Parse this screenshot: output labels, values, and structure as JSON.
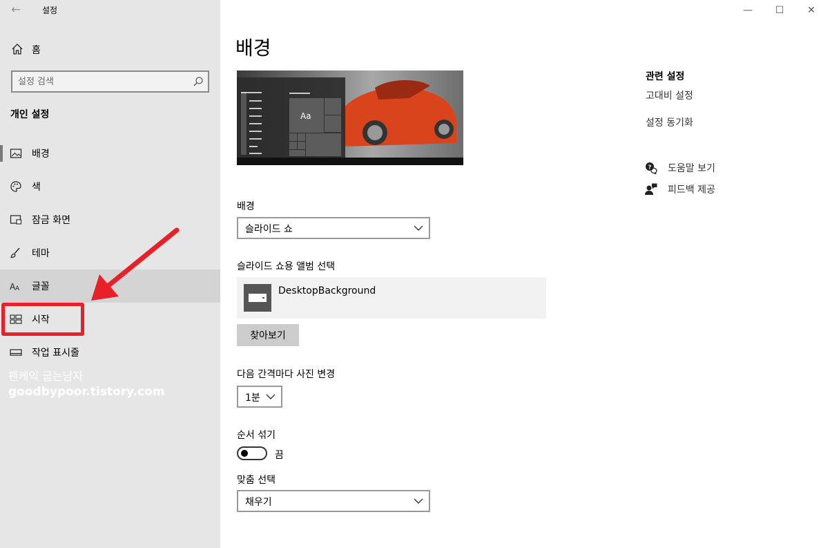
{
  "window": {
    "title": "설정",
    "back_glyph": "←",
    "minimize_glyph": "—",
    "maximize_glyph": "☐",
    "close_glyph": "✕"
  },
  "sidebar": {
    "home_label": "홈",
    "search_placeholder": "설정 검색",
    "section_title": "개인 설정",
    "items": [
      {
        "label": "배경",
        "icon": "picture-icon"
      },
      {
        "label": "색",
        "icon": "palette-icon"
      },
      {
        "label": "잠금 화면",
        "icon": "lock-screen-icon"
      },
      {
        "label": "테마",
        "icon": "theme-brush-icon"
      },
      {
        "label": "글꼴",
        "icon": "font-icon"
      },
      {
        "label": "시작",
        "icon": "start-tiles-icon"
      },
      {
        "label": "작업 표시줄",
        "icon": "taskbar-icon"
      }
    ]
  },
  "watermark": {
    "line1": "팬케익 굽는남자",
    "line2": "goodbypoor.tistory.com"
  },
  "main": {
    "title": "배경",
    "preview_sample_text": "Aa",
    "background_label": "배경",
    "background_value": "슬라이드 쇼",
    "album_label": "슬라이드 쇼용 앨범 선택",
    "album_name": "DesktopBackground",
    "browse_label": "찾아보기",
    "interval_label": "다음 간격마다 사진 변경",
    "interval_value": "1분",
    "shuffle_label": "순서 섞기",
    "shuffle_state": "끔",
    "fit_label": "맞춤 선택",
    "fit_value": "채우기"
  },
  "related": {
    "title": "관련 설정",
    "links": [
      "고대비 설정",
      "설정 동기화"
    ],
    "help_label": "도움말 보기",
    "feedback_label": "피드백 제공"
  },
  "colors": {
    "annotation_red": "#e8202a",
    "sidebar_bg": "#e6e6e6"
  }
}
